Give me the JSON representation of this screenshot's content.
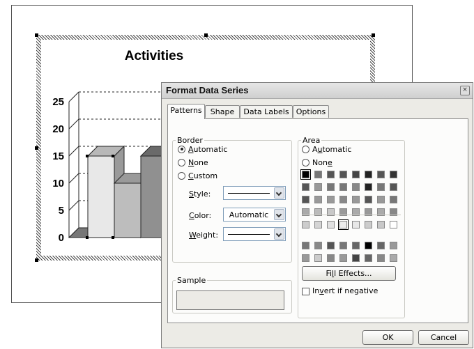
{
  "chart_data": {
    "type": "bar",
    "title": "Activities",
    "categories": [
      "",
      "",
      "",
      ""
    ],
    "series": [
      {
        "values": [
          0,
          15,
          10,
          15
        ]
      }
    ],
    "ylim": [
      0,
      25
    ],
    "yticks": [
      "0",
      "5",
      "10",
      "15",
      "20",
      "25"
    ],
    "grid": true,
    "style": "3d-column"
  },
  "dialog": {
    "title": "Format Data Series",
    "close_symbol": "×",
    "tabs": [
      {
        "label": "Patterns",
        "active": true
      },
      {
        "label": "Shape"
      },
      {
        "label": "Data Labels"
      },
      {
        "label": "Options"
      }
    ],
    "border": {
      "legend": "Border",
      "options": [
        {
          "prefix": "",
          "key": "A",
          "rest": "utomatic",
          "selected": true
        },
        {
          "prefix": "",
          "key": "N",
          "rest": "one",
          "selected": false
        },
        {
          "prefix": "",
          "key": "C",
          "rest": "ustom",
          "selected": false
        }
      ],
      "style_label": {
        "key": "S",
        "rest": "tyle:"
      },
      "color_label": {
        "key": "C",
        "rest": "olor:"
      },
      "weight_label": {
        "key": "W",
        "rest": "eight:"
      },
      "color_value": "Automatic"
    },
    "sample": {
      "legend": "Sample"
    },
    "area": {
      "legend": "Area",
      "automatic": {
        "prefix": "A",
        "key": "u",
        "rest": "tomatic",
        "selected": false
      },
      "none": {
        "prefix": "Non",
        "key": "e",
        "rest": "",
        "selected": false
      },
      "palette_top": [
        [
          "#000000",
          "#777777",
          "#555555",
          "#555555",
          "#444444",
          "#222222",
          "#555555",
          "#333333"
        ],
        [
          "#555555",
          "#999999",
          "#777777",
          "#777777",
          "#888888",
          "#222222",
          "#777777",
          "#555555"
        ],
        [
          "#555555",
          "#999999",
          "#999999",
          "#888888",
          "#999999",
          "#555555",
          "#999999",
          "#777777"
        ],
        [
          "#aaaaaa",
          "#bbbbbb",
          "#c8c8c8",
          "#999999",
          "#aaaaaa",
          "#999999",
          "#aaaaaa",
          "#888888"
        ],
        [
          "#cccccc",
          "#d4d4d4",
          "#e0e0e0",
          "#ececec",
          "#e8e8e8",
          "#cccccc",
          "#c8c8c8",
          "#ffffff"
        ]
      ],
      "palette_bottom": [
        [
          "#777777",
          "#888888",
          "#555555",
          "#777777",
          "#666666",
          "#000000",
          "#666666",
          "#999999"
        ],
        [
          "#999999",
          "#cccccc",
          "#888888",
          "#999999",
          "#444444",
          "#666666",
          "#888888",
          "#aaaaaa"
        ]
      ],
      "fill_effects": {
        "prefix": "Fi",
        "key": "l",
        "rest": "l Effects..."
      },
      "invert": {
        "prefix": "In",
        "key": "v",
        "rest": "ert if negative",
        "checked": false
      }
    },
    "ok_label": "OK",
    "cancel_label": "Cancel"
  }
}
